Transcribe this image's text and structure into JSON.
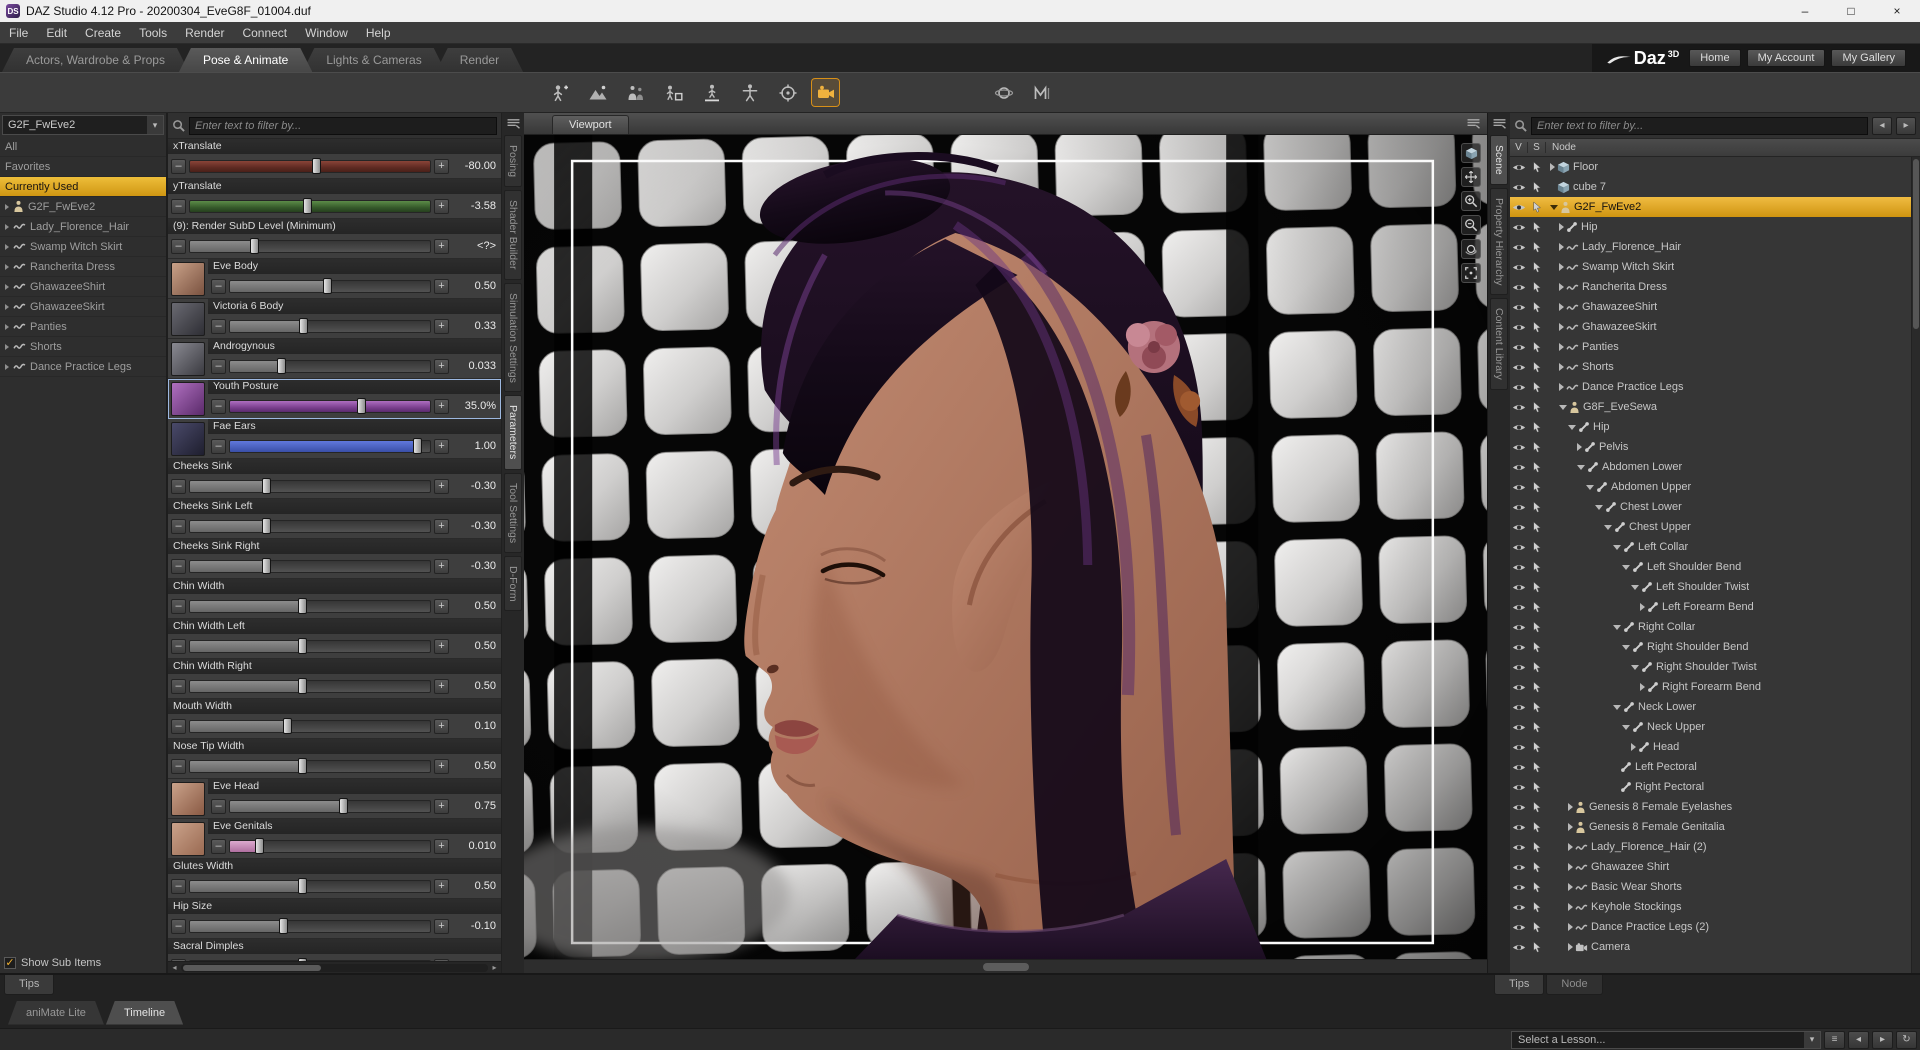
{
  "window": {
    "title": "DAZ Studio 4.12 Pro - 20200304_EveG8F_01004.duf",
    "controls": {
      "minimize": "–",
      "maximize": "□",
      "close": "×"
    }
  },
  "menu": {
    "items": [
      "File",
      "Edit",
      "Create",
      "Tools",
      "Render",
      "Connect",
      "Window",
      "Help"
    ]
  },
  "activity_tabs": {
    "items": [
      {
        "label": "Actors, Wardrobe & Props",
        "active": false
      },
      {
        "label": "Pose & Animate",
        "active": true
      },
      {
        "label": "Lights & Cameras",
        "active": false
      },
      {
        "label": "Render",
        "active": false
      }
    ]
  },
  "brand": {
    "name": "Daz",
    "sup": "3D",
    "links": [
      "Home",
      "My Account",
      "My Gallery"
    ]
  },
  "toolbar": {
    "buttons": [
      {
        "name": "add-figure-button",
        "icon": "add-figure",
        "active": false
      },
      {
        "name": "environment-button",
        "icon": "environment",
        "active": false
      },
      {
        "name": "figure-group-button",
        "icon": "figure-group",
        "active": false
      },
      {
        "name": "figure-prop-button",
        "icon": "figure-prop",
        "active": false
      },
      {
        "name": "drop-to-floor-button",
        "icon": "drop-floor",
        "active": false
      },
      {
        "name": "t-pose-button",
        "icon": "tpose",
        "active": false
      },
      {
        "name": "aim-at-button",
        "icon": "aim",
        "active": false
      },
      {
        "name": "active-camera-button",
        "icon": "camera-tool",
        "active": true
      },
      {
        "name": "orbit-sphere-button",
        "icon": "orbit",
        "active": false,
        "gap": true
      },
      {
        "name": "measure-button",
        "icon": "measure",
        "active": false
      }
    ]
  },
  "left_panel": {
    "selector_value": "G2F_FwEve2",
    "items": [
      {
        "label": "All"
      },
      {
        "label": "Favorites"
      },
      {
        "label": "Currently Used",
        "selected": true
      },
      {
        "label": "G2F_FwEve2",
        "icon": "figure",
        "arrow": true
      },
      {
        "label": "Lady_Florence_Hair",
        "icon": "wave",
        "arrow": true
      },
      {
        "label": "Swamp Witch Skirt",
        "icon": "wave",
        "arrow": true
      },
      {
        "label": "Rancherita Dress",
        "icon": "wave",
        "arrow": true
      },
      {
        "label": "GhawazeeShirt",
        "icon": "wave",
        "arrow": true
      },
      {
        "label": "GhawazeeSkirt",
        "icon": "wave",
        "arrow": true
      },
      {
        "label": "Panties",
        "icon": "wave",
        "arrow": true
      },
      {
        "label": "Shorts",
        "icon": "wave",
        "arrow": true
      },
      {
        "label": "Dance Practice Legs",
        "icon": "wave",
        "arrow": true
      }
    ],
    "show_sub_items_label": "Show Sub Items",
    "bottom_tab": "Tips"
  },
  "parameters": {
    "search_placeholder": "Enter text to filter by...",
    "side_tabs": [
      {
        "label": "Posing",
        "active": false
      },
      {
        "label": "Shader Builder",
        "active": false
      },
      {
        "label": "Simulation Settings",
        "active": false
      },
      {
        "label": "Parameters",
        "active": true
      },
      {
        "label": "Tool Settings",
        "active": false
      },
      {
        "label": "D-Form",
        "active": false
      }
    ],
    "sliders": [
      {
        "label": "xTranslate",
        "value": "-80.00",
        "pct": 53,
        "track": "red"
      },
      {
        "label": "yTranslate",
        "value": "-3.58",
        "pct": 49,
        "track": "green"
      },
      {
        "label": "(9): Render SubD Level (Minimum)",
        "value": "<?>",
        "pct": 27,
        "track": "gray"
      },
      {
        "label": "Eve Body",
        "value": "0.50",
        "pct": 49,
        "track": "gray",
        "thumb": [
          "#c9a188",
          "#7a5240"
        ]
      },
      {
        "label": "Victoria 6 Body",
        "value": "0.33",
        "pct": 37,
        "track": "gray",
        "thumb": [
          "#6a6a72",
          "#2e2e34"
        ]
      },
      {
        "label": "Androgynous",
        "value": "0.033",
        "pct": 26,
        "track": "gray",
        "thumb": [
          "#8a8a92",
          "#3a3a40"
        ]
      },
      {
        "label": "Youth Posture",
        "value": "35.0%",
        "pct": 66,
        "track": "purple",
        "thumb": [
          "#b070c0",
          "#5a2a6a"
        ],
        "selected": true
      },
      {
        "label": "Fae Ears",
        "value": "1.00",
        "pct": 94,
        "track": "blue",
        "thumb": [
          "#4a4a6a",
          "#1e1e2e"
        ]
      },
      {
        "label": "Cheeks Sink",
        "value": "-0.30",
        "pct": 32,
        "track": "gray"
      },
      {
        "label": "Cheeks Sink Left",
        "value": "-0.30",
        "pct": 32,
        "track": "gray"
      },
      {
        "label": "Cheeks Sink Right",
        "value": "-0.30",
        "pct": 32,
        "track": "gray"
      },
      {
        "label": "Chin Width",
        "value": "0.50",
        "pct": 47,
        "track": "gray"
      },
      {
        "label": "Chin Width Left",
        "value": "0.50",
        "pct": 47,
        "track": "gray"
      },
      {
        "label": "Chin Width Right",
        "value": "0.50",
        "pct": 47,
        "track": "gray"
      },
      {
        "label": "Mouth Width",
        "value": "0.10",
        "pct": 41,
        "track": "gray"
      },
      {
        "label": "Nose Tip Width",
        "value": "0.50",
        "pct": 47,
        "track": "gray"
      },
      {
        "label": "Eve Head",
        "value": "0.75",
        "pct": 57,
        "track": "gray",
        "thumb": [
          "#caa28a",
          "#8a5a44"
        ]
      },
      {
        "label": "Eve Genitals",
        "value": "0.010",
        "pct": 15,
        "track": "pink",
        "thumb": [
          "#caa28a",
          "#9a6a52"
        ]
      },
      {
        "label": "Glutes Width",
        "value": "0.50",
        "pct": 47,
        "track": "gray"
      },
      {
        "label": "Hip Size",
        "value": "-0.10",
        "pct": 39,
        "track": "gray"
      },
      {
        "label": "Sacral Dimples",
        "value": "",
        "pct": 47,
        "track": "gray"
      }
    ]
  },
  "viewport": {
    "tab_label": "Viewport"
  },
  "scene_panel": {
    "search_placeholder": "Enter text to filter by...",
    "columns": [
      "V",
      "S",
      "Node"
    ],
    "side_tabs": [
      {
        "label": "Scene",
        "active": true
      },
      {
        "label": "Property Hierarchy",
        "active": false
      },
      {
        "label": "Content Library",
        "active": false
      }
    ],
    "nodes": [
      {
        "label": "Floor",
        "icon": "cube",
        "indent": 0,
        "arrow": "right"
      },
      {
        "label": "cube 7",
        "icon": "cube",
        "indent": 0,
        "arrow": "none"
      },
      {
        "label": "G2F_FwEve2",
        "icon": "figure",
        "indent": 0,
        "arrow": "down",
        "selected": true
      },
      {
        "label": "Hip",
        "icon": "bone",
        "indent": 1,
        "arrow": "right"
      },
      {
        "label": "Lady_Florence_Hair",
        "icon": "wave",
        "indent": 1,
        "arrow": "right"
      },
      {
        "label": "Swamp Witch Skirt",
        "icon": "wave",
        "indent": 1,
        "arrow": "right"
      },
      {
        "label": "Rancherita Dress",
        "icon": "wave",
        "indent": 1,
        "arrow": "right"
      },
      {
        "label": "GhawazeeShirt",
        "icon": "wave",
        "indent": 1,
        "arrow": "right"
      },
      {
        "label": "GhawazeeSkirt",
        "icon": "wave",
        "indent": 1,
        "arrow": "right"
      },
      {
        "label": "Panties",
        "icon": "wave",
        "indent": 1,
        "arrow": "right"
      },
      {
        "label": "Shorts",
        "icon": "wave",
        "indent": 1,
        "arrow": "right"
      },
      {
        "label": "Dance Practice Legs",
        "icon": "wave",
        "indent": 1,
        "arrow": "right"
      },
      {
        "label": "G8F_EveSewa",
        "icon": "figure",
        "indent": 1,
        "arrow": "down"
      },
      {
        "label": "Hip",
        "icon": "bone",
        "indent": 2,
        "arrow": "down"
      },
      {
        "label": "Pelvis",
        "icon": "bone",
        "indent": 3,
        "arrow": "right"
      },
      {
        "label": "Abdomen Lower",
        "icon": "bone",
        "indent": 3,
        "arrow": "down"
      },
      {
        "label": "Abdomen Upper",
        "icon": "bone",
        "indent": 4,
        "arrow": "down"
      },
      {
        "label": "Chest Lower",
        "icon": "bone",
        "indent": 5,
        "arrow": "down"
      },
      {
        "label": "Chest Upper",
        "icon": "bone",
        "indent": 6,
        "arrow": "down"
      },
      {
        "label": "Left Collar",
        "icon": "bone",
        "indent": 7,
        "arrow": "down"
      },
      {
        "label": "Left Shoulder Bend",
        "icon": "bone",
        "indent": 8,
        "arrow": "down"
      },
      {
        "label": "Left Shoulder Twist",
        "icon": "bone",
        "indent": 9,
        "arrow": "down"
      },
      {
        "label": "Left Forearm Bend",
        "icon": "bone",
        "indent": 10,
        "arrow": "right"
      },
      {
        "label": "Right Collar",
        "icon": "bone",
        "indent": 7,
        "arrow": "down"
      },
      {
        "label": "Right Shoulder Bend",
        "icon": "bone",
        "indent": 8,
        "arrow": "down"
      },
      {
        "label": "Right Shoulder Twist",
        "icon": "bone",
        "indent": 9,
        "arrow": "down"
      },
      {
        "label": "Right Forearm Bend",
        "icon": "bone",
        "indent": 10,
        "arrow": "right"
      },
      {
        "label": "Neck Lower",
        "icon": "bone",
        "indent": 7,
        "arrow": "down"
      },
      {
        "label": "Neck Upper",
        "icon": "bone",
        "indent": 8,
        "arrow": "down"
      },
      {
        "label": "Head",
        "icon": "bone",
        "indent": 9,
        "arrow": "right"
      },
      {
        "label": "Left Pectoral",
        "icon": "bone",
        "indent": 7,
        "arrow": "none"
      },
      {
        "label": "Right Pectoral",
        "icon": "bone",
        "indent": 7,
        "arrow": "none"
      },
      {
        "label": "Genesis 8 Female Eyelashes",
        "icon": "figure",
        "indent": 2,
        "arrow": "right"
      },
      {
        "label": "Genesis 8 Female Genitalia",
        "icon": "figure",
        "indent": 2,
        "arrow": "right"
      },
      {
        "label": "Lady_Florence_Hair (2)",
        "icon": "wave",
        "indent": 2,
        "arrow": "right"
      },
      {
        "label": "Ghawazee Shirt",
        "icon": "wave",
        "indent": 2,
        "arrow": "right"
      },
      {
        "label": "Basic Wear Shorts",
        "icon": "wave",
        "indent": 2,
        "arrow": "right"
      },
      {
        "label": "Keyhole Stockings",
        "icon": "wave",
        "indent": 2,
        "arrow": "right"
      },
      {
        "label": "Dance Practice Legs (2)",
        "icon": "wave",
        "indent": 2,
        "arrow": "right"
      },
      {
        "label": "Camera",
        "icon": "camera",
        "indent": 2,
        "arrow": "right"
      }
    ],
    "bottom_tabs": [
      {
        "label": "Tips",
        "active": true
      },
      {
        "label": "Node",
        "active": false
      }
    ]
  },
  "timeline": {
    "tabs": [
      {
        "label": "aniMate Lite",
        "active": false
      },
      {
        "label": "Timeline",
        "active": true
      }
    ]
  },
  "lesson_bar": {
    "placeholder": "Select a Lesson...",
    "buttons": [
      {
        "name": "lesson-menu-button",
        "glyph": "≡"
      },
      {
        "name": "lesson-prev-button",
        "glyph": "◂"
      },
      {
        "name": "lesson-next-button",
        "glyph": "▸"
      },
      {
        "name": "lesson-refresh-button",
        "glyph": "↻"
      }
    ]
  },
  "colors": {
    "selection": "#d79b28",
    "accent_orange": "#e8a020",
    "frame": "#fafafa"
  }
}
